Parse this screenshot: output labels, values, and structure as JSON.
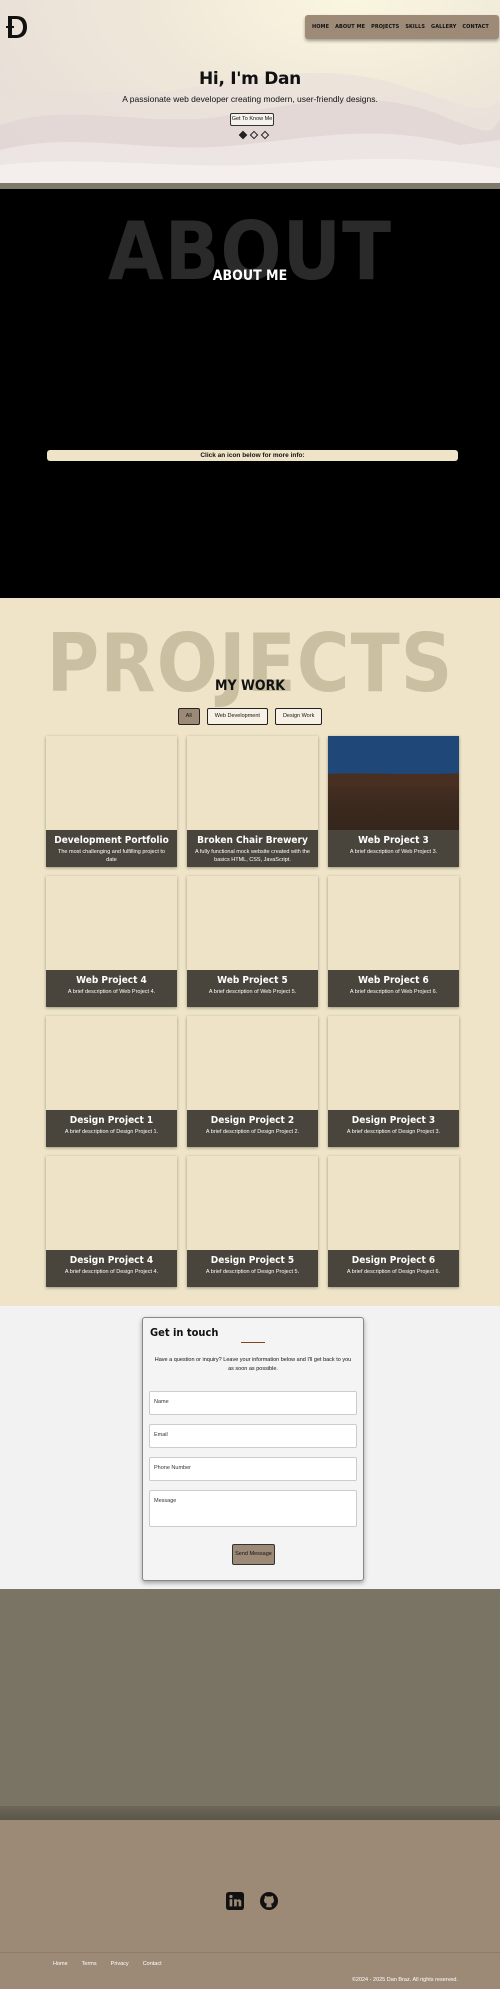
{
  "nav": {
    "items": [
      "HOME",
      "ABOUT ME",
      "PROJECTS",
      "SKILLS",
      "GALLERY",
      "CONTACT"
    ]
  },
  "hero": {
    "title": "Hi, I'm Dan",
    "tagline": "A passionate web developer creating modern, user-friendly designs.",
    "cta": "Get To Know Me"
  },
  "about": {
    "watermark": "ABOUT",
    "heading": "ABOUT ME",
    "info_bar": "Click an icon below for more info:"
  },
  "projects": {
    "watermark": "PROJECTS",
    "heading": "MY WORK",
    "filters": [
      "All",
      "Web Development",
      "Design Work"
    ],
    "active_filter": "All",
    "cards": [
      {
        "title": "Development Portfolio",
        "desc": "The most challenging and fulfilling project to date"
      },
      {
        "title": "Broken Chair Brewery",
        "desc": "A fully functional mock website created with the basics HTML, CSS, JavaScript."
      },
      {
        "title": "Web Project 3",
        "desc": "A brief description of Web Project 3."
      },
      {
        "title": "Web Project 4",
        "desc": "A brief description of Web Project 4."
      },
      {
        "title": "Web Project 5",
        "desc": "A brief description of Web Project 5."
      },
      {
        "title": "Web Project 6",
        "desc": "A brief description of Web Project 6."
      },
      {
        "title": "Design Project 1",
        "desc": "A brief description of Design Project 1."
      },
      {
        "title": "Design Project 2",
        "desc": "A brief description of Design Project 2."
      },
      {
        "title": "Design Project 3",
        "desc": "A brief description of Design Project 3."
      },
      {
        "title": "Design Project 4",
        "desc": "A brief description of Design Project 4."
      },
      {
        "title": "Design Project 5",
        "desc": "A brief description of Design Project 5."
      },
      {
        "title": "Design Project 6",
        "desc": "A brief description of Design Project 6."
      }
    ]
  },
  "contact": {
    "heading": "Get in touch",
    "intro": "Have a question or inquiry? Leave your information below and I'll get back to you as soon as possible.",
    "name_placeholder": "Name",
    "email_placeholder": "Email",
    "phone_placeholder": "Phone Number",
    "message_placeholder": "Message",
    "send": "Send Message"
  },
  "footer": {
    "links": [
      "Home",
      "Terms",
      "Privacy",
      "Contact"
    ],
    "copyright": "©2024 - 2025 Dan Braz. All rights reserved."
  },
  "colors": {
    "cream": "#efe4c8",
    "taupe": "#9c8a77",
    "card_caption": "#4a453c"
  },
  "icons": [
    "linkedin-icon",
    "github-icon"
  ]
}
